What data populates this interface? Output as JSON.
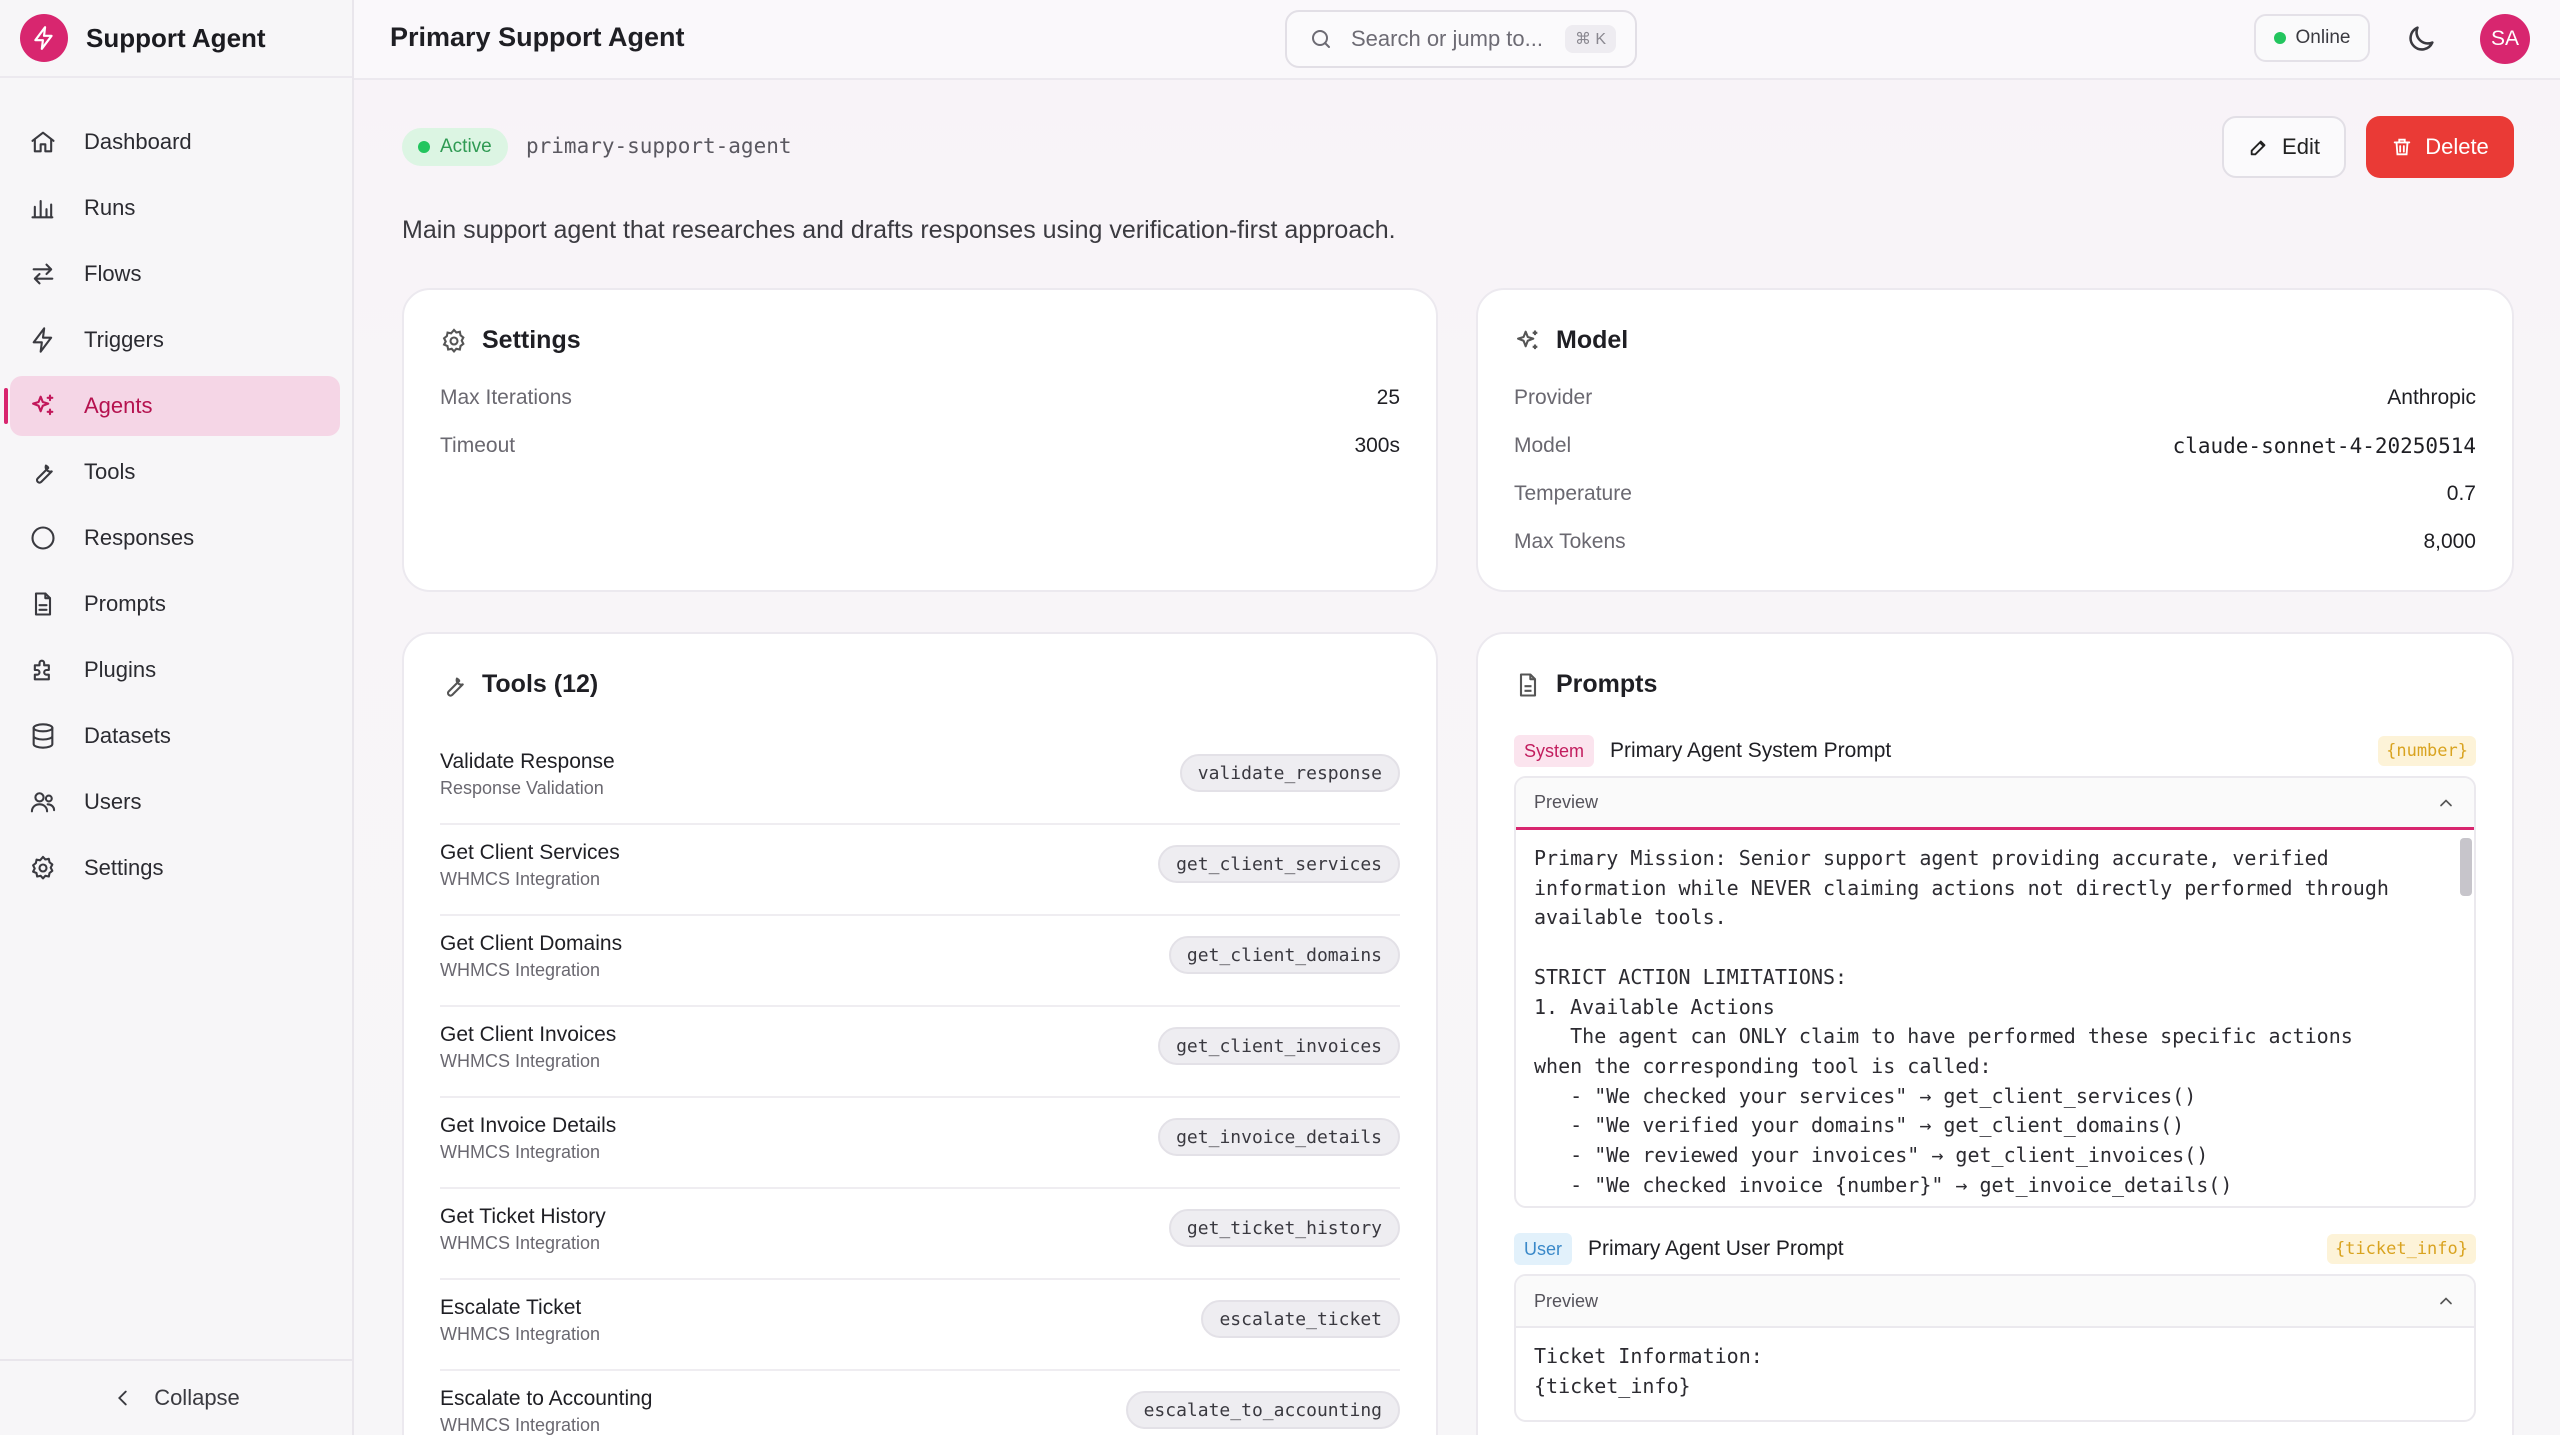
{
  "brand": {
    "name": "Support Agent"
  },
  "sidebar": {
    "items": [
      {
        "label": "Dashboard",
        "icon": "home-icon"
      },
      {
        "label": "Runs",
        "icon": "bar-chart-icon"
      },
      {
        "label": "Flows",
        "icon": "arrows-icon"
      },
      {
        "label": "Triggers",
        "icon": "bolt-icon"
      },
      {
        "label": "Agents",
        "icon": "sparkles-icon",
        "active": true
      },
      {
        "label": "Tools",
        "icon": "wrench-icon"
      },
      {
        "label": "Responses",
        "icon": "circle-icon"
      },
      {
        "label": "Prompts",
        "icon": "document-icon"
      },
      {
        "label": "Plugins",
        "icon": "puzzle-icon"
      },
      {
        "label": "Datasets",
        "icon": "database-icon"
      },
      {
        "label": "Users",
        "icon": "users-icon"
      },
      {
        "label": "Settings",
        "icon": "gear-icon"
      }
    ],
    "collapse_label": "Collapse"
  },
  "header": {
    "title": "Primary Support Agent",
    "search_placeholder": "Search or jump to...",
    "search_shortcut": "⌘ K",
    "status": "Online",
    "avatar_initials": "SA"
  },
  "agent": {
    "status": "Active",
    "slug": "primary-support-agent",
    "description": "Main support agent that researches and drafts responses using verification-first approach.",
    "edit_label": "Edit",
    "delete_label": "Delete"
  },
  "settings": {
    "title": "Settings",
    "rows": [
      {
        "key": "Max Iterations",
        "value": "25"
      },
      {
        "key": "Timeout",
        "value": "300s"
      }
    ]
  },
  "model": {
    "title": "Model",
    "rows": [
      {
        "key": "Provider",
        "value": "Anthropic"
      },
      {
        "key": "Model",
        "value": "claude-sonnet-4-20250514"
      },
      {
        "key": "Temperature",
        "value": "0.7"
      },
      {
        "key": "Max Tokens",
        "value": "8,000"
      }
    ]
  },
  "tools": {
    "title": "Tools (12)",
    "items": [
      {
        "name": "Validate Response",
        "category": "Response Validation",
        "id": "validate_response"
      },
      {
        "name": "Get Client Services",
        "category": "WHMCS Integration",
        "id": "get_client_services"
      },
      {
        "name": "Get Client Domains",
        "category": "WHMCS Integration",
        "id": "get_client_domains"
      },
      {
        "name": "Get Client Invoices",
        "category": "WHMCS Integration",
        "id": "get_client_invoices"
      },
      {
        "name": "Get Invoice Details",
        "category": "WHMCS Integration",
        "id": "get_invoice_details"
      },
      {
        "name": "Get Ticket History",
        "category": "WHMCS Integration",
        "id": "get_ticket_history"
      },
      {
        "name": "Escalate Ticket",
        "category": "WHMCS Integration",
        "id": "escalate_ticket"
      },
      {
        "name": "Escalate to Accounting",
        "category": "WHMCS Integration",
        "id": "escalate_to_accounting"
      }
    ]
  },
  "prompts": {
    "title": "Prompts",
    "system": {
      "tag": "System",
      "name": "Primary Agent System Prompt",
      "variable": "{number}",
      "preview_label": "Preview",
      "lines": [
        "Primary Mission: Senior support agent providing accurate, verified",
        "information while NEVER claiming actions not directly performed through",
        "available tools.",
        "",
        "STRICT ACTION LIMITATIONS:",
        "1. Available Actions",
        "   The agent can ONLY claim to have performed these specific actions",
        "when the corresponding tool is called:",
        "   - \"We checked your services\" → get_client_services()",
        "   - \"We verified your domains\" → get_client_domains()",
        "   - \"We reviewed your invoices\" → get_client_invoices()",
        "   - \"We checked invoice {number}\" → get_invoice_details()"
      ]
    },
    "user": {
      "tag": "User",
      "name": "Primary Agent User Prompt",
      "variable": "{ticket_info}",
      "preview_label": "Preview",
      "lines": [
        "Ticket Information:",
        "{ticket_info}"
      ]
    }
  },
  "colors": {
    "accent": "#d8266f",
    "danger": "#ea3a36",
    "success": "#22c55e"
  }
}
